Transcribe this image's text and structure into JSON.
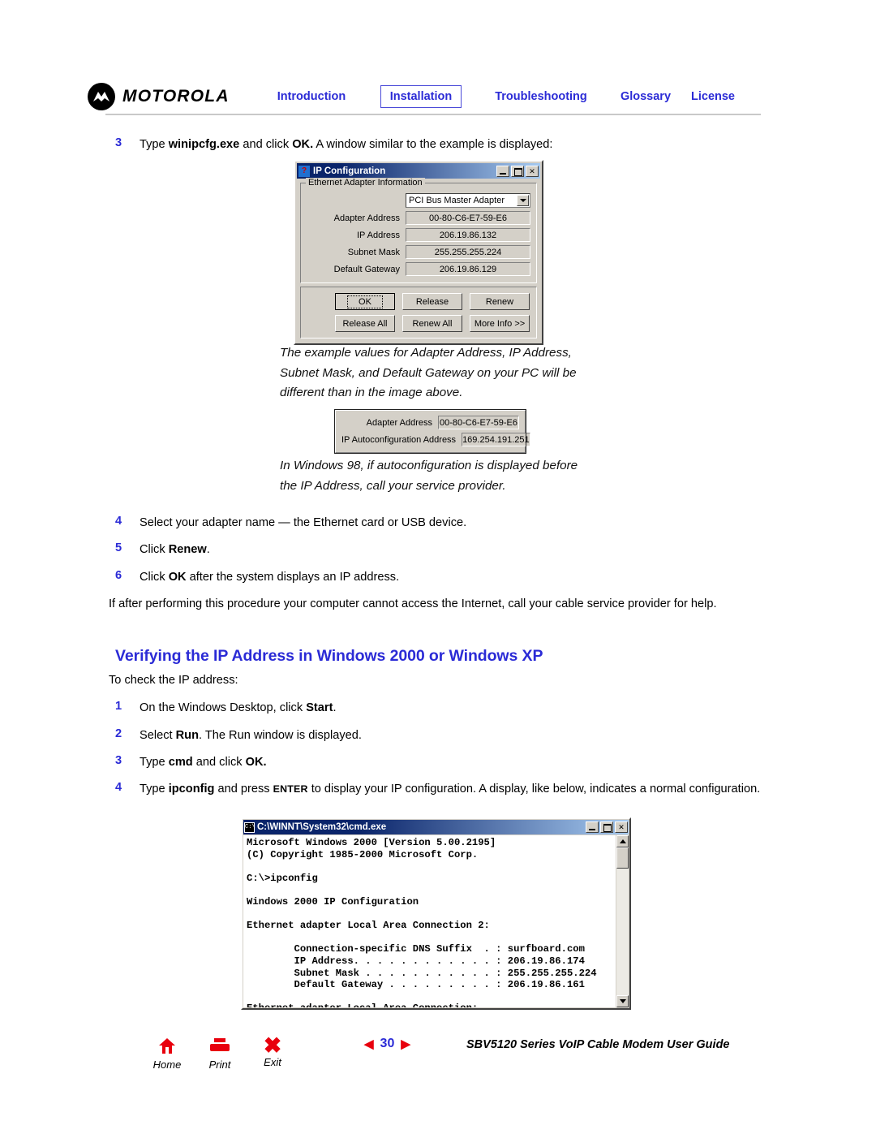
{
  "header": {
    "brand": "MOTOROLA",
    "nav": [
      {
        "label": "Introduction",
        "active": false
      },
      {
        "label": "Installation",
        "active": true
      },
      {
        "label": "Troubleshooting",
        "active": false
      },
      {
        "label": "Glossary",
        "active": false
      },
      {
        "label": "License",
        "active": false
      }
    ]
  },
  "steps_win9x": {
    "step3_num": "3",
    "step3_a": "Type ",
    "step3_b": "winipcfg.exe",
    "step3_c": " and click ",
    "step3_d": "OK.",
    "step3_e": " A window similar to the example is displayed:",
    "step4_num": "4",
    "step4_text": "Select your adapter name — the Ethernet card or USB device.",
    "step5_num": "5",
    "step5_a": "Click ",
    "step5_b": "Renew",
    "step5_c": ".",
    "step6_num": "6",
    "step6_a": "Click ",
    "step6_b": "OK",
    "step6_c": " after the system displays an IP address.",
    "closing": "If after performing this procedure your computer cannot access the Internet, call your cable service provider for help."
  },
  "ip_config_dialog": {
    "title": "IP Configuration",
    "icon": "winipcfg-icon",
    "minimize": "minimize-button",
    "maximize": "maximize-button",
    "close": "✕",
    "group_title": "Ethernet  Adapter Information",
    "adapter_select": "PCI Bus Master Adapter",
    "fields": [
      {
        "label": "Adapter Address",
        "value": "00-80-C6-E7-59-E6"
      },
      {
        "label": "IP Address",
        "value": "206.19.86.132"
      },
      {
        "label": "Subnet Mask",
        "value": "255.255.255.224"
      },
      {
        "label": "Default Gateway",
        "value": "206.19.86.129"
      }
    ],
    "buttons_row1": [
      "OK",
      "Release",
      "Renew"
    ],
    "buttons_row2": [
      "Release All",
      "Renew All",
      "More Info >>"
    ]
  },
  "note1": "The example values for Adapter Address, IP Address, Subnet Mask, and Default Gateway on your PC will be different than in the image above.",
  "note2": "In Windows 98, if autoconfiguration is displayed before the IP Address, call your service provider.",
  "autoconfig_dialog": {
    "fields": [
      {
        "label": "Adapter Address",
        "value": "00-80-C6-E7-59-E6"
      },
      {
        "label": "IP Autoconfiguration Address",
        "value": "169.254.191.251"
      }
    ]
  },
  "section2": {
    "heading": "Verifying the IP Address in Windows 2000 or Windows XP",
    "intro": "To check the IP address:",
    "s1_num": "1",
    "s1_a": "On the Windows Desktop, click ",
    "s1_b": "Start",
    "s1_c": ".",
    "s2_num": "2",
    "s2_a": "Select ",
    "s2_b": "Run",
    "s2_c": ". The Run window is displayed.",
    "s3_num": "3",
    "s3_a": "Type ",
    "s3_b": "cmd",
    "s3_c": " and click ",
    "s3_d": "OK.",
    "s4_num": "4",
    "s4_a": "Type ",
    "s4_b": "ipconfig",
    "s4_c": " and press ",
    "s4_d": "ENTER",
    "s4_e": " to display your IP configuration. A display, like below, indicates a normal configuration."
  },
  "cmd_window": {
    "title": "C:\\WINNT\\System32\\cmd.exe",
    "icon": "cmd-icon",
    "minimize": "minimize-button",
    "maximize": "maximize-button",
    "close": "✕",
    "text": "Microsoft Windows 2000 [Version 5.00.2195]\n(C) Copyright 1985-2000 Microsoft Corp.\n\nC:\\>ipconfig\n\nWindows 2000 IP Configuration\n\nEthernet adapter Local Area Connection 2:\n\n        Connection-specific DNS Suffix  . : surfboard.com\n        IP Address. . . . . . . . . . . . : 206.19.86.174\n        Subnet Mask . . . . . . . . . . . : 255.255.255.224\n        Default Gateway . . . . . . . . . : 206.19.86.161\n\nEthernet adapter Local Area Connection:\n\n        Media State . . . . . . . . . . . : Cable Disconnected\n\nC:\\>"
  },
  "footer": {
    "home_label": "Home",
    "home_icon": "home-icon",
    "print_label": "Print",
    "print_icon": "printer-icon",
    "exit_label": "Exit",
    "exit_icon": "x-icon",
    "prev_icon": "◀",
    "next_icon": "▶",
    "page": "30",
    "guide": "SBV5120 Series VoIP Cable Modem User Guide"
  },
  "colors": {
    "link_blue": "#2b2bd6",
    "accent_red": "#e8000d",
    "dialog_face": "#d4d0c8",
    "titlebar_blue": "#0a246a"
  }
}
